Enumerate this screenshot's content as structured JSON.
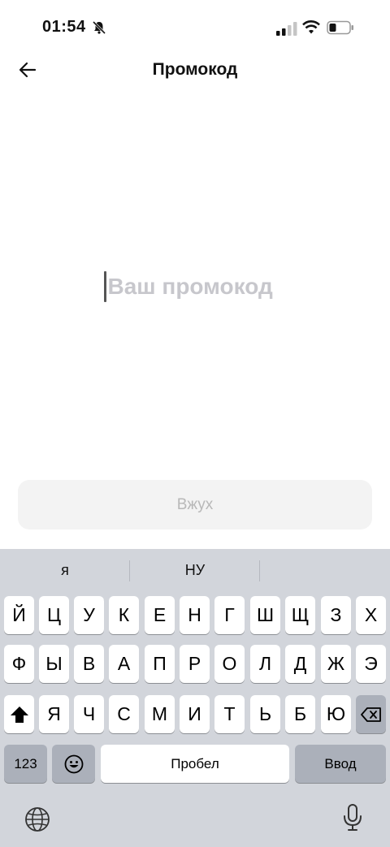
{
  "status_bar": {
    "time": "01:54",
    "icons": [
      "bell-slash-icon",
      "cellular-signal-icon",
      "wifi-icon",
      "battery-icon"
    ]
  },
  "header": {
    "title": "Промокод",
    "back_icon": "arrow-left-icon"
  },
  "promo": {
    "placeholder": "Ваш промокод",
    "value": ""
  },
  "submit": {
    "label": "Вжух",
    "enabled": false
  },
  "keyboard": {
    "suggestions": [
      "я",
      "НУ",
      ""
    ],
    "row1": [
      "Й",
      "Ц",
      "У",
      "К",
      "Е",
      "Н",
      "Г",
      "Ш",
      "Щ",
      "З",
      "Х"
    ],
    "row2": [
      "Ф",
      "Ы",
      "В",
      "А",
      "П",
      "Р",
      "О",
      "Л",
      "Д",
      "Ж",
      "Э"
    ],
    "row3": [
      "Я",
      "Ч",
      "С",
      "М",
      "И",
      "Т",
      "Ь",
      "Б",
      "Ю"
    ],
    "numbers_label": "123",
    "space_label": "Пробел",
    "enter_label": "Ввод",
    "icons": [
      "shift-icon",
      "backspace-icon",
      "emoji-icon",
      "globe-icon",
      "microphone-icon"
    ]
  },
  "colors": {
    "keyboard_bg": "#d2d5db",
    "key_bg": "#ffffff",
    "special_key_bg": "#abb0ba",
    "placeholder": "#c7c7cc",
    "button_disabled_bg": "#f3f3f3",
    "button_disabled_text": "#b8b8b8"
  }
}
